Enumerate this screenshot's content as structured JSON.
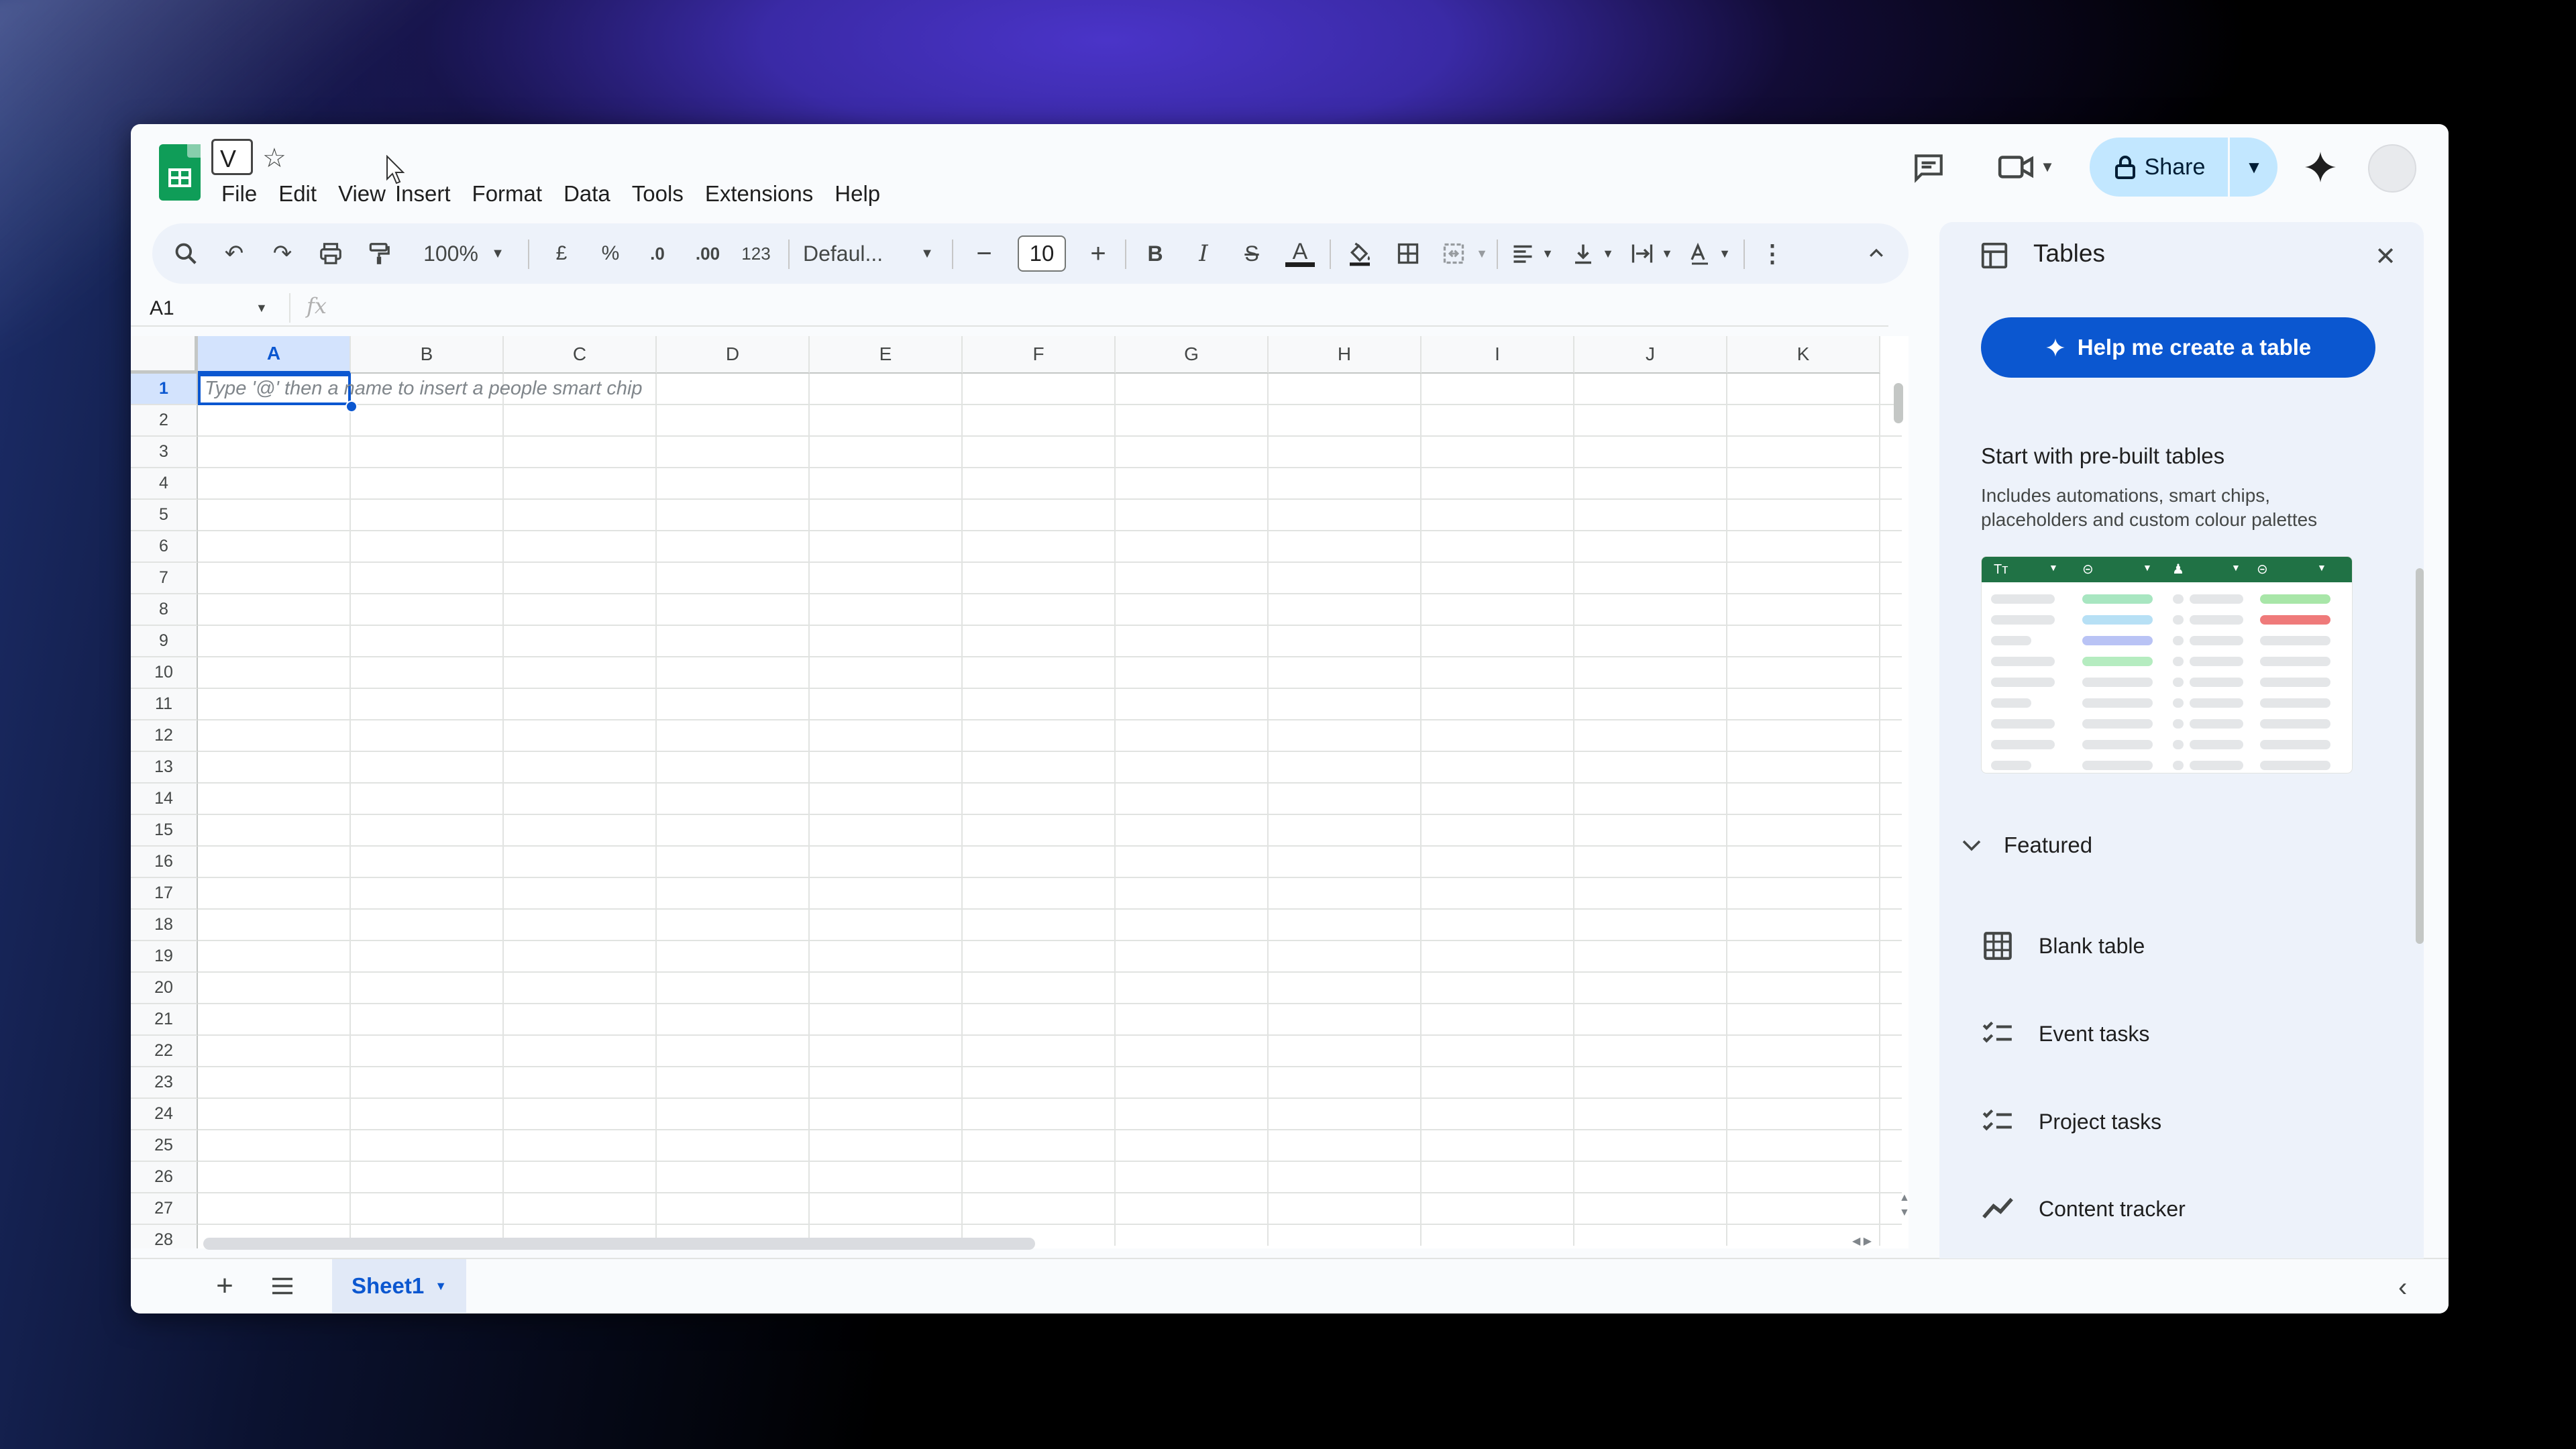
{
  "window": {
    "doc_title_char": "V",
    "menu": [
      "File",
      "Edit",
      "View",
      "Insert",
      "Format",
      "Data",
      "Tools",
      "Extensions",
      "Help"
    ]
  },
  "header": {
    "share_label": "Share"
  },
  "toolbar": {
    "zoom": "100%",
    "currency": "£",
    "percent": "%",
    "dec_decrease": ".0",
    "dec_increase": ".00",
    "number_format": "123",
    "font": "Defaul...",
    "font_size": "10",
    "bold": "B",
    "italic": "I",
    "strikethrough": "S",
    "text_color": "A"
  },
  "formula_bar": {
    "cell_ref": "A1",
    "fx": "fx"
  },
  "grid": {
    "columns": [
      "A",
      "B",
      "C",
      "D",
      "E",
      "F",
      "G",
      "H",
      "I",
      "J",
      "K"
    ],
    "rows": [
      "1",
      "2",
      "3",
      "4",
      "5",
      "6",
      "7",
      "8",
      "9",
      "10",
      "11",
      "12",
      "13",
      "14",
      "15",
      "16",
      "17",
      "18",
      "19",
      "20",
      "21",
      "22",
      "23",
      "24",
      "25",
      "26",
      "27",
      "28"
    ],
    "selected_cell": "A1",
    "a1_placeholder": "Type '@' then a name to insert a people smart chip"
  },
  "bottom": {
    "sheet_tab": "Sheet1"
  },
  "panel": {
    "title": "Tables",
    "help_button": "Help me create a table",
    "prebuilt_title": "Start with pre-built tables",
    "prebuilt_desc": "Includes automations, smart chips, placeholders and custom colour palettes",
    "preview_header_text": "Tт",
    "featured": "Featured",
    "items": [
      "Blank table",
      "Event tasks",
      "Project tasks",
      "Content tracker"
    ],
    "item_icons": [
      "table-icon",
      "checklist-icon",
      "checklist-icon",
      "trend-icon"
    ]
  },
  "colors": {
    "accent": "#0b57d0",
    "share_bg": "#c2e7ff",
    "sheets_green": "#0f9d58",
    "panel_bg": "#edf2fa"
  }
}
